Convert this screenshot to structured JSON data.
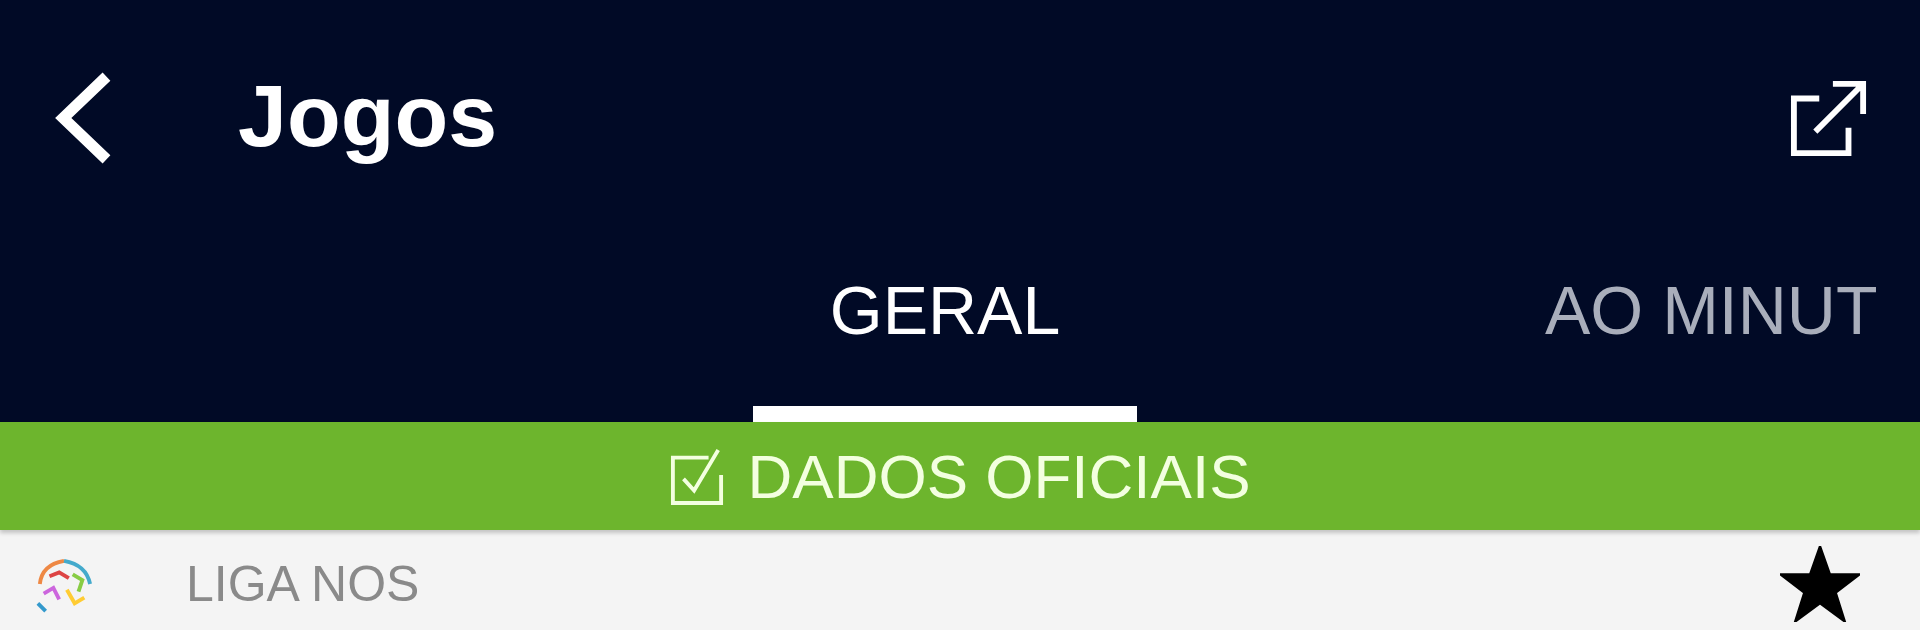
{
  "app_bar": {
    "title": "Jogos"
  },
  "tabs": [
    {
      "label": "GERAL",
      "selected": true
    },
    {
      "label": "AO MINUT",
      "selected": false
    }
  ],
  "banner": {
    "label": "DADOS OFICIAIS",
    "checked": true
  },
  "competitions": [
    {
      "name": "LIGA NOS",
      "favorite": true
    }
  ]
}
